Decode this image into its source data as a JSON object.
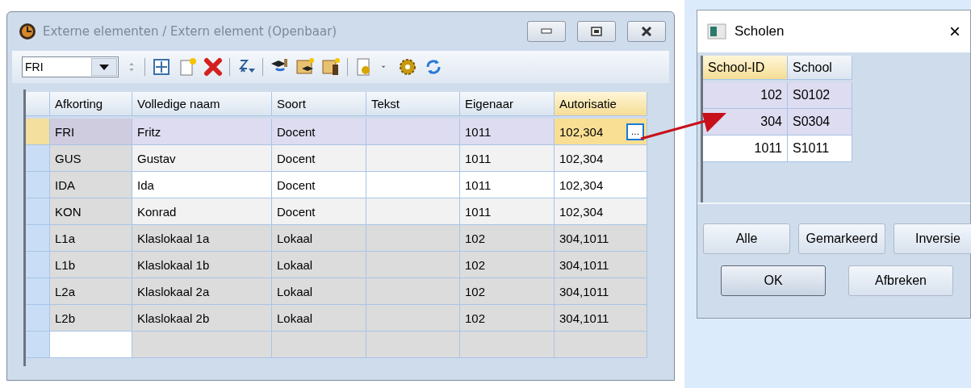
{
  "main_window": {
    "title": "Externe elementen / Extern element (Openbaar)",
    "active": false,
    "toolbar": {
      "combo_value": "FRI"
    },
    "table": {
      "columns": [
        "Afkorting",
        "Volledige naam",
        "Soort",
        "Tekst",
        "Eigenaar",
        "Autorisatie"
      ],
      "rows": [
        {
          "cells": [
            "FRI",
            "Fritz",
            "Docent",
            "",
            "1011",
            "102,304"
          ],
          "selected": true,
          "kind": "teacher"
        },
        {
          "cells": [
            "GUS",
            "Gustav",
            "Docent",
            "",
            "1011",
            "102,304"
          ],
          "selected": false,
          "kind": "teacher"
        },
        {
          "cells": [
            "IDA",
            "Ida",
            "Docent",
            "",
            "1011",
            "102,304"
          ],
          "selected": false,
          "kind": "teacher"
        },
        {
          "cells": [
            "KON",
            "Konrad",
            "Docent",
            "",
            "1011",
            "102,304"
          ],
          "selected": false,
          "kind": "teacher"
        },
        {
          "cells": [
            "L1a",
            "Klaslokaal 1a",
            "Lokaal",
            "",
            "102",
            "304,1011"
          ],
          "selected": false,
          "kind": "room"
        },
        {
          "cells": [
            "L1b",
            "Klaslokaal 1b",
            "Lokaal",
            "",
            "102",
            "304,1011"
          ],
          "selected": false,
          "kind": "room"
        },
        {
          "cells": [
            "L2a",
            "Klaslokaal 2a",
            "Lokaal",
            "",
            "102",
            "304,1011"
          ],
          "selected": false,
          "kind": "room"
        },
        {
          "cells": [
            "L2b",
            "Klaslokaal 2b",
            "Lokaal",
            "",
            "102",
            "304,1011"
          ],
          "selected": false,
          "kind": "room"
        }
      ],
      "ellipsis_button": "..."
    }
  },
  "dialog": {
    "title": "Scholen",
    "close": "×",
    "table": {
      "columns": [
        "School-ID",
        "School"
      ],
      "rows": [
        {
          "id": "102",
          "school": "S0102",
          "selected": true
        },
        {
          "id": "304",
          "school": "S0304",
          "selected": true
        },
        {
          "id": "1011",
          "school": "S1011",
          "selected": false
        }
      ]
    },
    "buttons": [
      {
        "label": "Alle",
        "default": false
      },
      {
        "label": "Gemarkeerd",
        "default": false
      },
      {
        "label": "Inversie",
        "default": false
      }
    ],
    "actions": [
      {
        "label": "OK",
        "default": true
      },
      {
        "label": "Afbreken",
        "default": false
      }
    ]
  }
}
